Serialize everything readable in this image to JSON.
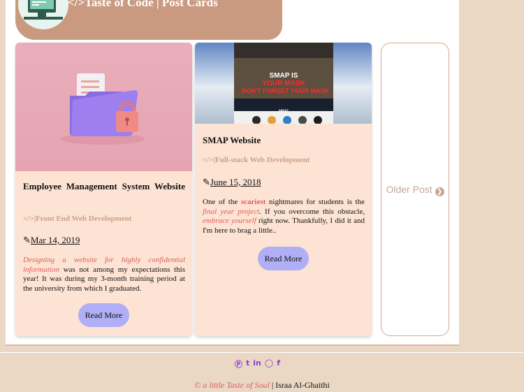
{
  "header": {
    "title": "</>Taste of Code | Post Cards"
  },
  "cards": [
    {
      "title": "Employee Management System Website",
      "category": "</>|Front End Web Development",
      "date": "Mar 14, 2019",
      "body_em": "Designing a website for highly confidential information",
      "body_rest": " was not among my expectations this year! It was during my 3-month training period at the university from which I graduated.",
      "button": "Read More"
    },
    {
      "title": "SMAP Website",
      "category": "</>|Full-stack Web Development",
      "date": "June 15, 2018",
      "body_1": "One of the ",
      "body_strong": "scariest",
      "body_2": " nightmares for students is the ",
      "body_em1": "final year project",
      "body_3": ". If you overcome this obstacle, ",
      "body_em2": "embrace yourself",
      "body_4": " right now. Thankfully, I did it and I'm here to brag a little..",
      "button": "Read More",
      "thumb_text_1": "SMAP IS",
      "thumb_text_2": "YOUR MASK",
      "thumb_text_3": ", DON'T FORGET YOUR MASK",
      "thumb_text_4": "ABOUT"
    }
  ],
  "older": {
    "label": "Older Post"
  },
  "footer": {
    "social": [
      "pinterest-icon",
      "tumblr-icon",
      "linkedin-icon",
      "instagram-icon",
      "facebook-icon"
    ],
    "credit_symbol": "©",
    "credit_italic": " a little Taste of Soul",
    "credit_sep": " | ",
    "credit_author": "Israa Al-Ghaithi"
  },
  "colors": {
    "accent": "#e05a5a",
    "button": "#b0aef5",
    "card": "#fde3d3",
    "header": "#c99a80",
    "social": "#8a3bd8"
  }
}
